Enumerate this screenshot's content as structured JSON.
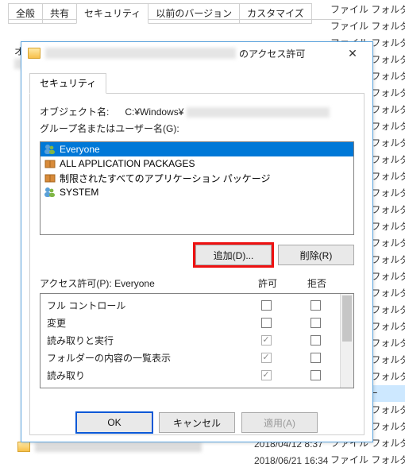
{
  "back_tabs": [
    "全般",
    "共有",
    "セキュリティ",
    "以前のバージョン",
    "カスタマイズ"
  ],
  "back_active_tab_index": 2,
  "bg_folder_label": "ファイル フォルダー",
  "bg_folder_label_short": "フォルダー",
  "bg_dates": [
    "2018/04/12 8:37",
    "2018/06/21 16:34"
  ],
  "dialog": {
    "title_suffix": " のアクセス許可",
    "close": "✕",
    "tab_label": "セキュリティ",
    "object_label": "オブジェクト名:",
    "object_path_prefix": "C:¥Windows¥",
    "groups_label": "グループ名またはユーザー名(G):",
    "groups": [
      {
        "name": "Everyone",
        "icon": "users",
        "selected": true
      },
      {
        "name": "ALL APPLICATION PACKAGES",
        "icon": "package",
        "selected": false
      },
      {
        "name": "制限されたすべてのアプリケーション パッケージ",
        "icon": "package",
        "selected": false
      },
      {
        "name": "SYSTEM",
        "icon": "users",
        "selected": false
      }
    ],
    "add_btn": "追加(D)...",
    "remove_btn": "削除(R)",
    "perm_label": "アクセス許可(P): Everyone",
    "col_allow": "許可",
    "col_deny": "拒否",
    "permissions": [
      {
        "label": "フル コントロール",
        "allow": false,
        "deny": false,
        "allow_disabled": false
      },
      {
        "label": "変更",
        "allow": false,
        "deny": false,
        "allow_disabled": false
      },
      {
        "label": "読み取りと実行",
        "allow": true,
        "deny": false,
        "allow_disabled": true
      },
      {
        "label": "フォルダーの内容の一覧表示",
        "allow": true,
        "deny": false,
        "allow_disabled": true
      },
      {
        "label": "読み取り",
        "allow": true,
        "deny": false,
        "allow_disabled": true
      }
    ],
    "ok_btn": "OK",
    "cancel_btn": "キャンセル",
    "apply_btn": "適用(A)"
  }
}
